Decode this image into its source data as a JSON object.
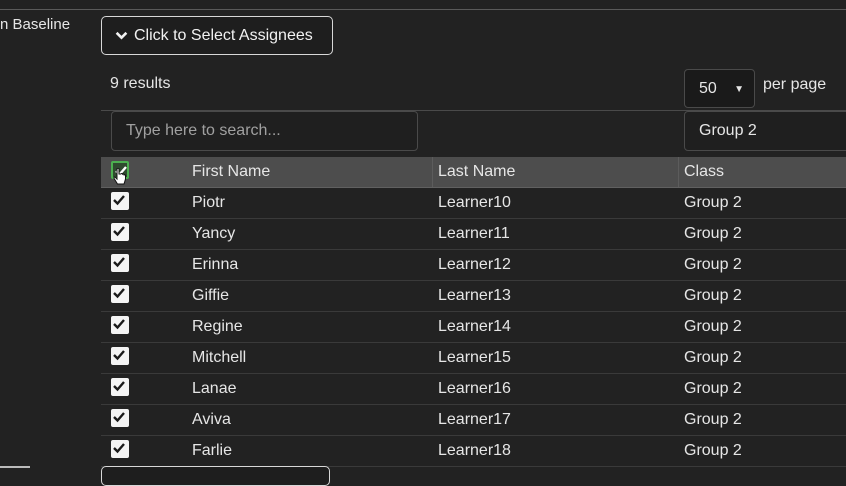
{
  "side_label": "n Baseline",
  "assignees_button": {
    "label": "Click to Select Assignees",
    "icon": "chevron-down-icon"
  },
  "results_text": "9 results",
  "pagination": {
    "per_page_value": "50",
    "per_page_label": "per page"
  },
  "search": {
    "placeholder": "Type here to search..."
  },
  "class_filter": {
    "value": "Group 2"
  },
  "table": {
    "headers": {
      "first": "First Name",
      "last": "Last Name",
      "class": "Class"
    },
    "rows": [
      {
        "first": "Piotr",
        "last": "Learner10",
        "class": "Group 2",
        "checked": true
      },
      {
        "first": "Yancy",
        "last": "Learner11",
        "class": "Group 2",
        "checked": true
      },
      {
        "first": "Erinna",
        "last": "Learner12",
        "class": "Group 2",
        "checked": true
      },
      {
        "first": "Giffie",
        "last": "Learner13",
        "class": "Group 2",
        "checked": true
      },
      {
        "first": "Regine",
        "last": "Learner14",
        "class": "Group 2",
        "checked": true
      },
      {
        "first": "Mitchell",
        "last": "Learner15",
        "class": "Group 2",
        "checked": true
      },
      {
        "first": "Lanae",
        "last": "Learner16",
        "class": "Group 2",
        "checked": true
      },
      {
        "first": "Aviva",
        "last": "Learner17",
        "class": "Group 2",
        "checked": true
      },
      {
        "first": "Farlie",
        "last": "Learner18",
        "class": "Group 2",
        "checked": true
      }
    ]
  },
  "colors": {
    "background": "#222222",
    "header_row": "#4d4d4d",
    "select_all_border": "#4caf50"
  }
}
